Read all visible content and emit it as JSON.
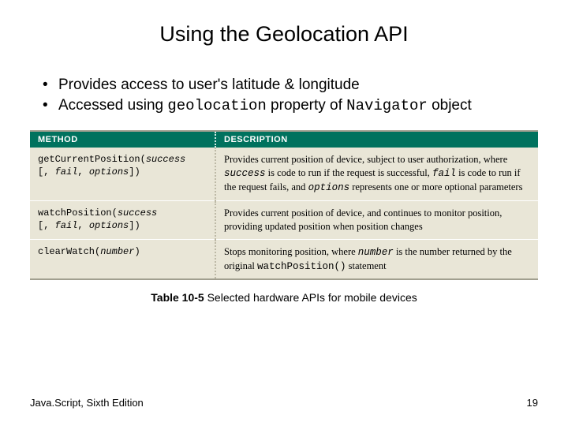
{
  "title": "Using the Geolocation API",
  "bullets": {
    "b1": "Provides access to user's latitude & longitude",
    "b2_pre": "Accessed using ",
    "b2_code1": "geolocation",
    "b2_mid": " property of ",
    "b2_code2": "Navigator",
    "b2_post": " object"
  },
  "table": {
    "header_method": "METHOD",
    "header_desc": "DESCRIPTION",
    "rows": [
      {
        "method_l1": "getCurrentPosition(",
        "method_arg1": "success",
        "method_l2": "[, ",
        "method_arg2": "fail",
        "method_l2b": ", ",
        "method_arg3": "options",
        "method_l2c": "])",
        "desc_pre": "Provides current position of device, subject to user authorization, where ",
        "desc_c1": "success",
        "desc_mid1": " is code to run if the request is successful, ",
        "desc_c2": "fail",
        "desc_mid2": " is code to run if the request fails, and ",
        "desc_c3": "options",
        "desc_post": " represents one or more optional parameters"
      },
      {
        "method_l1": "watchPosition(",
        "method_arg1": "success",
        "method_l2": "[, ",
        "method_arg2": "fail",
        "method_l2b": ", ",
        "method_arg3": "options",
        "method_l2c": "])",
        "desc_plain": "Provides current position of device, and continues to monitor position, providing updated position when position changes"
      },
      {
        "method_l1": "clearWatch(",
        "method_arg1": "number",
        "method_l1b": ")",
        "desc_pre": "Stops monitoring position, where ",
        "desc_c1": "number",
        "desc_mid1": " is the number returned by the original ",
        "desc_c2": "watchPosition()",
        "desc_post": " statement"
      }
    ]
  },
  "caption_bold": "Table 10-5",
  "caption_rest": " Selected hardware APIs for mobile devices",
  "footer_left": "Java.Script, Sixth Edition",
  "footer_right": "19"
}
